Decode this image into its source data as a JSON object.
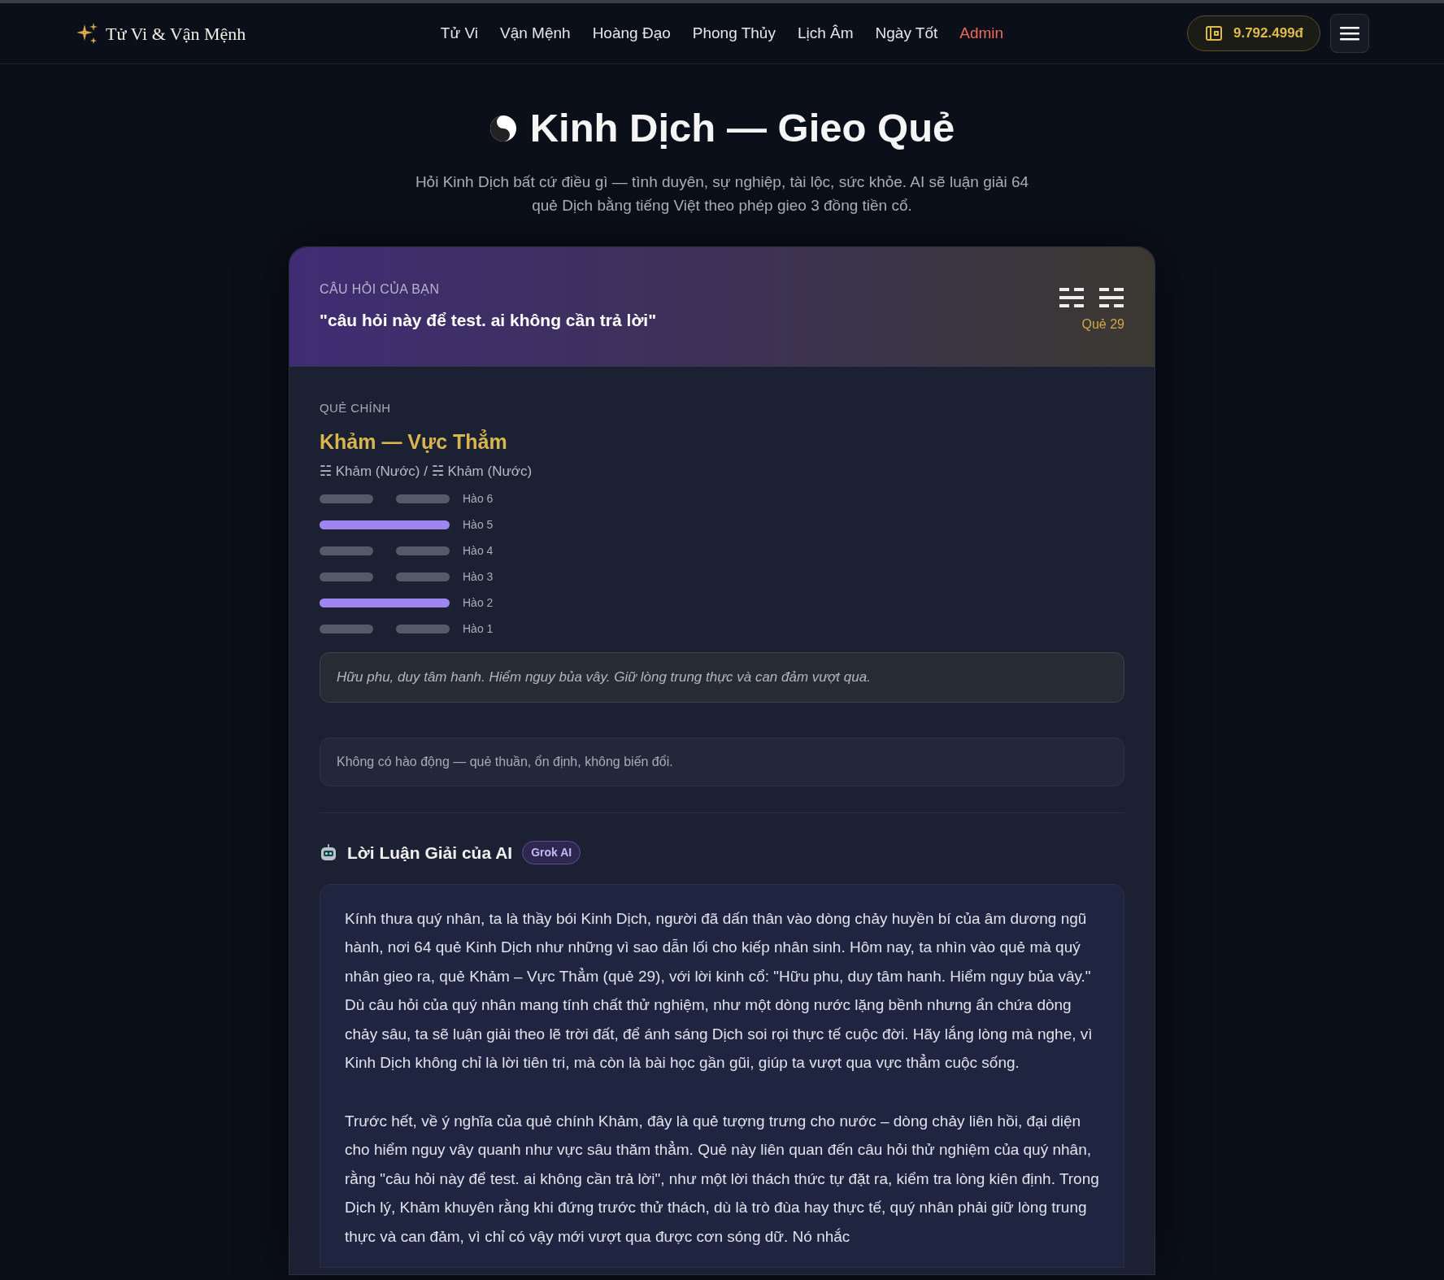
{
  "header": {
    "logo": "Tử Vi & Vận Mệnh",
    "nav": [
      {
        "label": "Tử Vi",
        "kind": "normal"
      },
      {
        "label": "Vận Mệnh",
        "kind": "normal"
      },
      {
        "label": "Hoàng Đạo",
        "kind": "normal"
      },
      {
        "label": "Phong Thủy",
        "kind": "normal"
      },
      {
        "label": "Lịch Âm",
        "kind": "normal"
      },
      {
        "label": "Ngày Tốt",
        "kind": "normal"
      },
      {
        "label": "Admin",
        "kind": "admin"
      }
    ],
    "balance": "9.792.499đ"
  },
  "page": {
    "title": "Kinh Dịch — Gieo Quẻ",
    "subtitle": "Hỏi Kinh Dịch bất cứ điều gì — tình duyên, sự nghiệp, tài lộc, sức khỏe. AI sẽ luận giải 64 quẻ Dịch bằng tiếng Việt theo phép gieo 3 đồng tiền cổ."
  },
  "question": {
    "label": "CÂU HỎI CỦA BẠN",
    "text": "\"câu hỏi này để test. ai không cần trả lời\"",
    "hexagram_number": "Quẻ 29"
  },
  "main_hexagram": {
    "label": "QUẺ CHÍNH",
    "name": "Khảm — Vực Thẳm",
    "trigrams": "☵ Khảm (Nước) / ☵ Khảm (Nước)",
    "lines": [
      {
        "label": "Hào 6",
        "kind": "yin"
      },
      {
        "label": "Hào 5",
        "kind": "yang"
      },
      {
        "label": "Hào 4",
        "kind": "yin"
      },
      {
        "label": "Hào 3",
        "kind": "yin"
      },
      {
        "label": "Hào 2",
        "kind": "yang"
      },
      {
        "label": "Hào 1",
        "kind": "yin"
      }
    ],
    "judgement": "Hữu phu, duy tâm hanh. Hiểm nguy bủa vây. Giữ lòng trung thực và can đảm vượt qua.",
    "changing_note": "Không có hào động — quẻ thuần, ổn định, không biến đổi."
  },
  "ai": {
    "title": "Lời Luận Giải của AI",
    "badge": "Grok AI",
    "paragraphs": [
      "Kính thưa quý nhân, ta là thầy bói Kinh Dịch, người đã dấn thân vào dòng chảy huyền bí của âm dương ngũ hành, nơi 64 quẻ Kinh Dịch như những vì sao dẫn lối cho kiếp nhân sinh. Hôm nay, ta nhìn vào quẻ mà quý nhân gieo ra, quẻ Khảm – Vực Thẳm (quẻ 29), với lời kinh cổ: \"Hữu phu, duy tâm hanh. Hiểm nguy bủa vây.\" Dù câu hỏi của quý nhân mang tính chất thử nghiệm, như một dòng nước lặng bềnh nhưng ẩn chứa dòng chảy sâu, ta sẽ luận giải theo lẽ trời đất, để ánh sáng Dịch soi rọi thực tế cuộc đời. Hãy lắng lòng mà nghe, vì Kinh Dịch không chỉ là lời tiên tri, mà còn là bài học gần gũi, giúp ta vượt qua vực thẳm cuộc sống.",
      "Trước hết, về ý nghĩa của quẻ chính Khảm, đây là quẻ tượng trưng cho nước – dòng chảy liên hồi, đại diện cho hiểm nguy vây quanh như vực sâu thăm thẳm. Quẻ này liên quan đến câu hỏi thử nghiệm của quý nhân, rằng \"câu hỏi này để test. ai không cần trả lời\", như một lời thách thức tự đặt ra, kiểm tra lòng kiên định. Trong Dịch lý, Khảm khuyên rằng khi đứng trước thử thách, dù là trò đùa hay thực tế, quý nhân phải giữ lòng trung thực và can đảm, vì chỉ có vậy mới vượt qua được cơn sóng dữ. Nó nhắc"
    ]
  }
}
